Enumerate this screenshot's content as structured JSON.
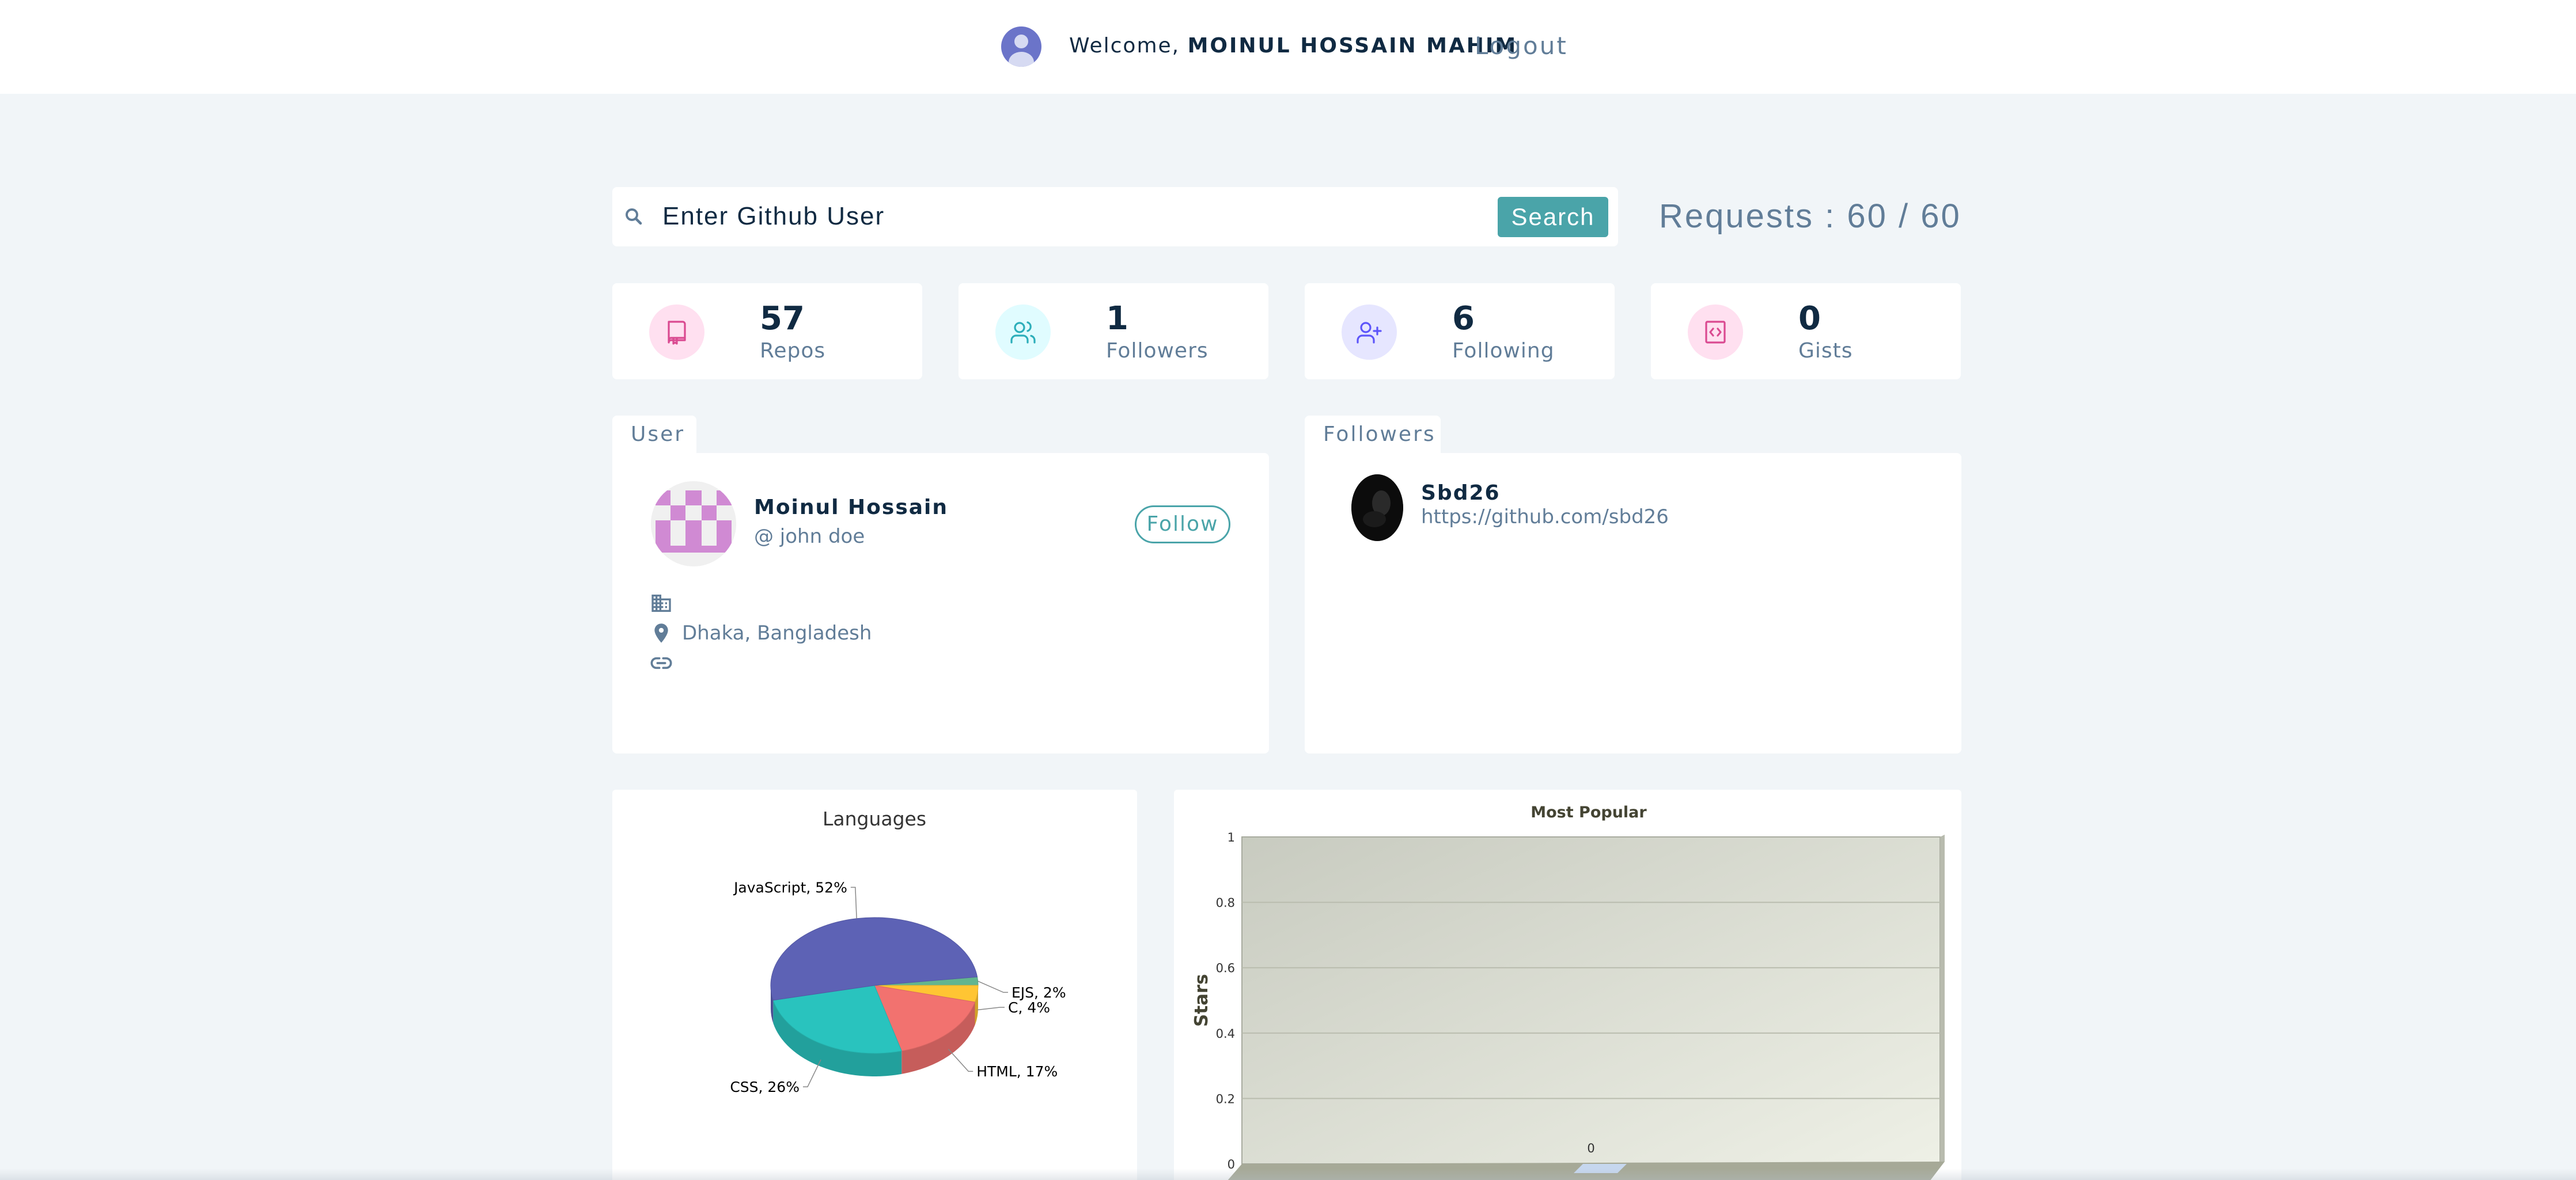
{
  "header": {
    "welcome_prefix": "Welcome,",
    "user_name": "MOINUL HOSSAIN MAHIM",
    "logout_label": "Logout"
  },
  "search": {
    "placeholder": "Enter Github User",
    "button_label": "Search",
    "requests_text": "Requests : 60 / 60"
  },
  "stats": [
    {
      "value": "57",
      "label": "Repos",
      "icon": "book-icon",
      "bg": "#ffe0f0",
      "color": "#da4a91"
    },
    {
      "value": "1",
      "label": "Followers",
      "icon": "users-icon",
      "bg": "#e0fcff",
      "color": "#2caeba"
    },
    {
      "value": "6",
      "label": "Following",
      "icon": "user-plus-icon",
      "bg": "#e6e6ff",
      "color": "#5d55fa"
    },
    {
      "value": "0",
      "label": "Gists",
      "icon": "code-icon",
      "bg": "#ffe0f0",
      "color": "#da4a91"
    }
  ],
  "user_panel": {
    "tab_label": "User",
    "name": "Moinul Hossain",
    "handle": "@ john doe",
    "follow_label": "Follow",
    "company": "",
    "location": "Dhaka, Bangladesh",
    "blog": ""
  },
  "followers_panel": {
    "tab_label": "Followers",
    "items": [
      {
        "login": "Sbd26",
        "url": "https://github.com/sbd26"
      }
    ]
  },
  "colors": {
    "accent": "#4aa4a9",
    "page_bg": "#f1f5f8",
    "text_dark": "#102a42",
    "text_muted": "#617d98"
  },
  "chart_data": [
    {
      "type": "pie",
      "title": "Languages",
      "categories": [
        "JavaScript",
        "CSS",
        "HTML",
        "C",
        "EJS"
      ],
      "values": [
        52,
        26,
        17,
        4,
        2
      ],
      "labels": [
        "JavaScript, 52%",
        "CSS, 26%",
        "HTML, 17%",
        "C, 4%",
        "EJS, 2%"
      ],
      "colors": [
        "#5d62b5",
        "#29c3be",
        "#f2726f",
        "#ffc533",
        "#62b58f"
      ],
      "style": "3d"
    },
    {
      "type": "bar",
      "title": "Most Popular",
      "ylabel": "Stars",
      "xlabel": "",
      "ylim": [
        0,
        1
      ],
      "yticks": [
        "0",
        "0.2",
        "0.4",
        "0.6",
        "0.8",
        "1"
      ],
      "values": [
        0
      ],
      "data_labels": [
        "0"
      ]
    }
  ]
}
